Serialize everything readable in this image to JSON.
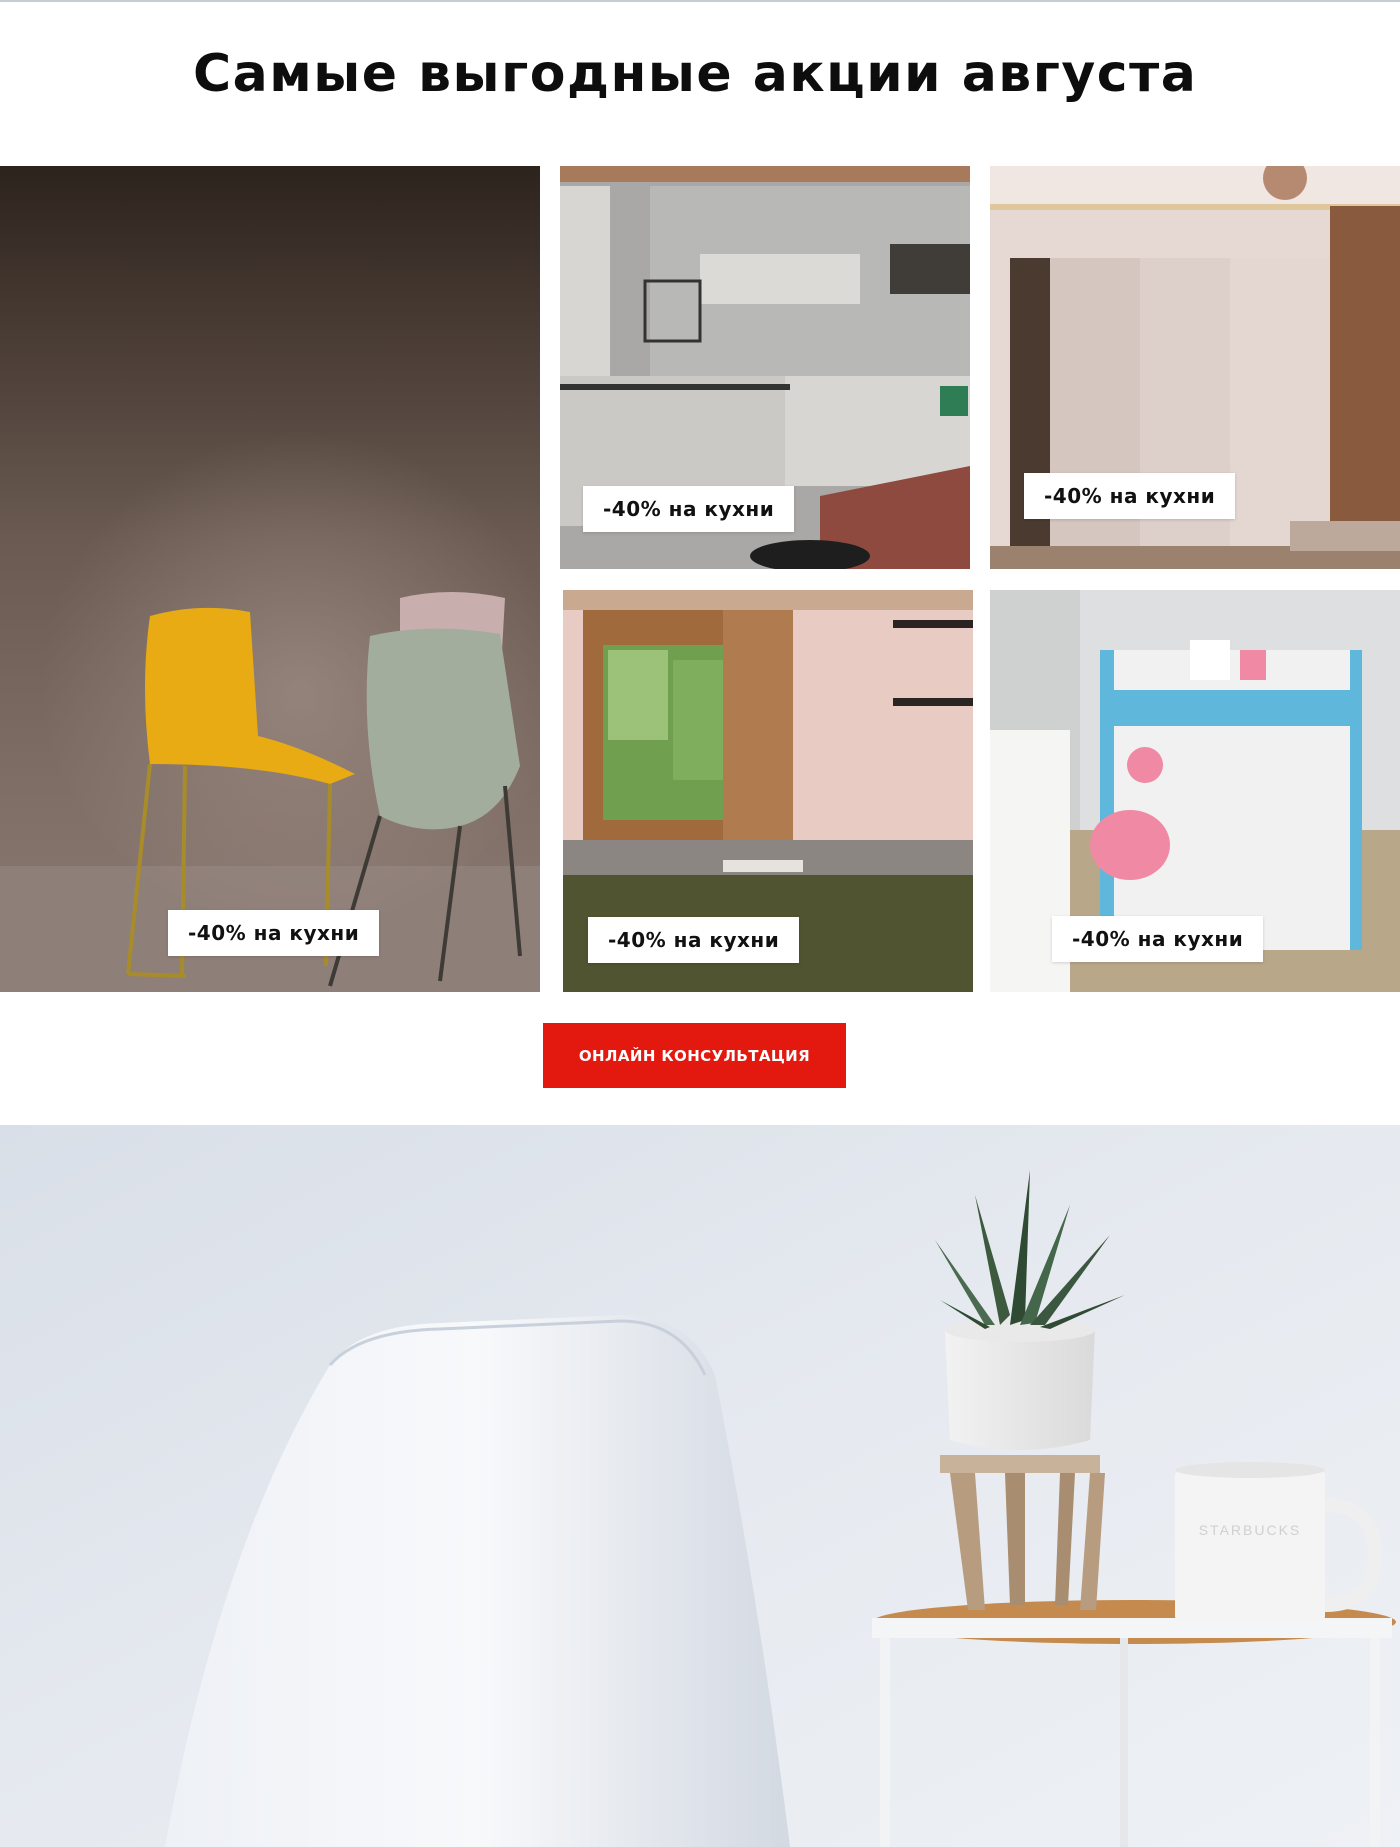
{
  "header": {
    "title": "Самые выгодные акции августа"
  },
  "promos": [
    {
      "badge": "-40% на кухни",
      "scene": "chairs-photo"
    },
    {
      "badge": "-40% на кухни",
      "scene": "kitchen-photo"
    },
    {
      "badge": "-40% на кухни",
      "scene": "wardrobe-photo"
    },
    {
      "badge": "-40% на кухни",
      "scene": "kitchen-window-photo"
    },
    {
      "badge": "-40% на кухни",
      "scene": "kids-desk-photo"
    }
  ],
  "cta": {
    "label": "ОНЛАЙН КОНСУЛЬТАЦИЯ"
  },
  "hero": {
    "scene": "chair-plant-mug-photo",
    "mug_text": "STARBUCKS"
  },
  "colors": {
    "accent": "#e3190f",
    "title": "#0d0d0d",
    "badge_bg": "#ffffff"
  }
}
